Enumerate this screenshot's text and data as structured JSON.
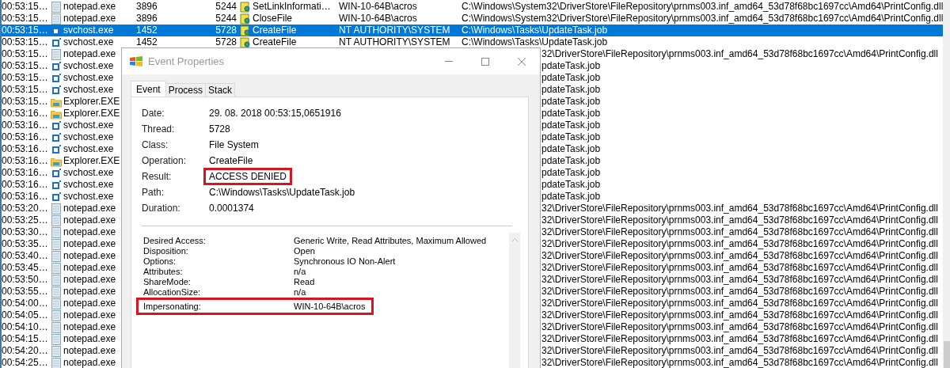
{
  "process_list": {
    "rows": [
      {
        "time": "00:53:15…",
        "process": "notepad.exe",
        "kind": "notepad",
        "pid": "3896",
        "tid": "5244",
        "operation": "SetLinkInformati…",
        "user": "WIN-10-64B\\acros",
        "path": "C:\\Windows\\System32\\DriverStore\\FileRepository\\prnms003.inf_amd64_53d78f68bc1697cc\\Amd64\\PrintConfig.dll",
        "selected": false
      },
      {
        "time": "00:53:15…",
        "process": "notepad.exe",
        "kind": "notepad",
        "pid": "3896",
        "tid": "5244",
        "operation": "CloseFile",
        "user": "WIN-10-64B\\acros",
        "path": "C:\\Windows\\System32\\DriverStore\\FileRepository\\prnms003.inf_amd64_53d78f68bc1697cc\\Amd64\\PrintConfig.dll",
        "selected": false
      },
      {
        "time": "00:53:15…",
        "process": "svchost.exe",
        "kind": "service",
        "pid": "1452",
        "tid": "5728",
        "operation": "CreateFile",
        "user": "NT AUTHORITY\\SYSTEM",
        "path": "C:\\Windows\\Tasks\\UpdateTask.job",
        "selected": true
      },
      {
        "time": "00:53:15…",
        "process": "svchost.exe",
        "kind": "service",
        "pid": "1452",
        "tid": "5728",
        "operation": "CreateFile",
        "user": "NT AUTHORITY\\SYSTEM",
        "path": "C:\\Windows\\Tasks\\UpdateTask.job",
        "selected": false
      },
      {
        "time": "00:53:15…",
        "process": "notepad.exe",
        "kind": "notepad",
        "path": "32\\DriverStore\\FileRepository\\prnms003.inf_amd64_53d78f68bc1697cc\\Amd64\\PrintConfig.dll",
        "selected": false
      },
      {
        "time": "00:53:15…",
        "process": "svchost.exe",
        "kind": "service",
        "path": "pdateTask.job",
        "selected": false
      },
      {
        "time": "00:53:15…",
        "process": "svchost.exe",
        "kind": "service",
        "path": "pdateTask.job",
        "selected": false
      },
      {
        "time": "00:53:15…",
        "process": "svchost.exe",
        "kind": "service",
        "path": "pdateTask.job",
        "selected": false
      },
      {
        "time": "00:53:15…",
        "process": "Explorer.EXE",
        "kind": "explorer",
        "path": "pdateTask.job",
        "selected": false
      },
      {
        "time": "00:53:16…",
        "process": "Explorer.EXE",
        "kind": "explorer",
        "path": "pdateTask.job",
        "selected": false
      },
      {
        "time": "00:53:16…",
        "process": "svchost.exe",
        "kind": "service",
        "path": "pdateTask.job",
        "selected": false
      },
      {
        "time": "00:53:16…",
        "process": "svchost.exe",
        "kind": "service",
        "path": "pdateTask.job",
        "selected": false
      },
      {
        "time": "00:53:16…",
        "process": "svchost.exe",
        "kind": "service",
        "path": "pdateTask.job",
        "selected": false
      },
      {
        "time": "00:53:16…",
        "process": "Explorer.EXE",
        "kind": "explorer",
        "path": "pdateTask.job",
        "selected": false
      },
      {
        "time": "00:53:16…",
        "process": "svchost.exe",
        "kind": "service",
        "path": "pdateTask.job",
        "selected": false
      },
      {
        "time": "00:53:16…",
        "process": "svchost.exe",
        "kind": "service",
        "path": "pdateTask.job",
        "selected": false
      },
      {
        "time": "00:53:16…",
        "process": "svchost.exe",
        "kind": "service",
        "path": "pdateTask.job",
        "selected": false
      },
      {
        "time": "00:53:20…",
        "process": "notepad.exe",
        "kind": "notepad",
        "path": "32\\DriverStore\\FileRepository\\prnms003.inf_amd64_53d78f68bc1697cc\\Amd64\\PrintConfig.dll",
        "selected": false
      },
      {
        "time": "00:53:25…",
        "process": "notepad.exe",
        "kind": "notepad",
        "path": "32\\DriverStore\\FileRepository\\prnms003.inf_amd64_53d78f68bc1697cc\\Amd64\\PrintConfig.dll",
        "selected": false
      },
      {
        "time": "00:53:30…",
        "process": "notepad.exe",
        "kind": "notepad",
        "path": "32\\DriverStore\\FileRepository\\prnms003.inf_amd64_53d78f68bc1697cc\\Amd64\\PrintConfig.dll",
        "selected": false
      },
      {
        "time": "00:53:35…",
        "process": "notepad.exe",
        "kind": "notepad",
        "path": "32\\DriverStore\\FileRepository\\prnms003.inf_amd64_53d78f68bc1697cc\\Amd64\\PrintConfig.dll",
        "selected": false
      },
      {
        "time": "00:53:40…",
        "process": "notepad.exe",
        "kind": "notepad",
        "path": "32\\DriverStore\\FileRepository\\prnms003.inf_amd64_53d78f68bc1697cc\\Amd64\\PrintConfig.dll",
        "selected": false
      },
      {
        "time": "00:53:45…",
        "process": "notepad.exe",
        "kind": "notepad",
        "path": "32\\DriverStore\\FileRepository\\prnms003.inf_amd64_53d78f68bc1697cc\\Amd64\\PrintConfig.dll",
        "selected": false
      },
      {
        "time": "00:53:50…",
        "process": "notepad.exe",
        "kind": "notepad",
        "path": "32\\DriverStore\\FileRepository\\prnms003.inf_amd64_53d78f68bc1697cc\\Amd64\\PrintConfig.dll",
        "selected": false
      },
      {
        "time": "00:53:55…",
        "process": "notepad.exe",
        "kind": "notepad",
        "path": "32\\DriverStore\\FileRepository\\prnms003.inf_amd64_53d78f68bc1697cc\\Amd64\\PrintConfig.dll",
        "selected": false
      },
      {
        "time": "00:54:00…",
        "process": "notepad.exe",
        "kind": "notepad",
        "path": "32\\DriverStore\\FileRepository\\prnms003.inf_amd64_53d78f68bc1697cc\\Amd64\\PrintConfig.dll",
        "selected": false
      },
      {
        "time": "00:54:05…",
        "process": "notepad.exe",
        "kind": "notepad",
        "path": "32\\DriverStore\\FileRepository\\prnms003.inf_amd64_53d78f68bc1697cc\\Amd64\\PrintConfig.dll",
        "selected": false
      },
      {
        "time": "00:54:10…",
        "process": "notepad.exe",
        "kind": "notepad",
        "path": "32\\DriverStore\\FileRepository\\prnms003.inf_amd64_53d78f68bc1697cc\\Amd64\\PrintConfig.dll",
        "selected": false
      },
      {
        "time": "00:54:15…",
        "process": "notepad.exe",
        "kind": "notepad",
        "path": "32\\DriverStore\\FileRepository\\prnms003.inf_amd64_53d78f68bc1697cc\\Amd64\\PrintConfig.dll",
        "selected": false
      },
      {
        "time": "00:54:20…",
        "process": "notepad.exe",
        "kind": "notepad",
        "path": "32\\DriverStore\\FileRepository\\prnms003.inf_amd64_53d78f68bc1697cc\\Amd64\\PrintConfig.dll",
        "selected": false
      },
      {
        "time": "00:54:25…",
        "process": "notepad.exe",
        "kind": "notepad",
        "path": "32\\DriverStore\\FileRepository\\prnms003.inf_amd64_53d78f68bc1697cc\\Amd64\\PrintConfig.dll",
        "selected": false
      }
    ]
  },
  "dialog": {
    "title": "Event Properties",
    "tabs": [
      {
        "label": "Event",
        "selected": true
      },
      {
        "label": "Process",
        "selected": false
      },
      {
        "label": "Stack",
        "selected": false
      }
    ],
    "fields": [
      {
        "label": "Date:",
        "value": "29. 08. 2018 00:53:15,0651916",
        "highlighted": false
      },
      {
        "label": "Thread:",
        "value": "5728",
        "highlighted": false
      },
      {
        "label": "Class:",
        "value": "File System",
        "highlighted": false
      },
      {
        "label": "Operation:",
        "value": "CreateFile",
        "highlighted": false
      },
      {
        "label": "Result:",
        "value": "ACCESS DENIED",
        "highlighted": true
      },
      {
        "label": "Path:",
        "value": "C:\\Windows\\Tasks\\UpdateTask.job",
        "highlighted": false
      },
      {
        "label": "Duration:",
        "value": "0.0001374",
        "highlighted": false
      }
    ],
    "details": [
      {
        "label": "Desired Access:",
        "value": "Generic Write, Read Attributes, Maximum Allowed",
        "highlighted": false
      },
      {
        "label": "Disposition:",
        "value": "Open",
        "highlighted": false
      },
      {
        "label": "Options:",
        "value": "Synchronous IO Non-Alert",
        "highlighted": false
      },
      {
        "label": "Attributes:",
        "value": "n/a",
        "highlighted": false
      },
      {
        "label": "ShareMode:",
        "value": "Read",
        "highlighted": false
      },
      {
        "label": "AllocationSize:",
        "value": "n/a",
        "highlighted": false
      },
      {
        "label": "Impersonating:",
        "value": "WIN-10-64B\\acros",
        "highlighted": true
      }
    ]
  }
}
